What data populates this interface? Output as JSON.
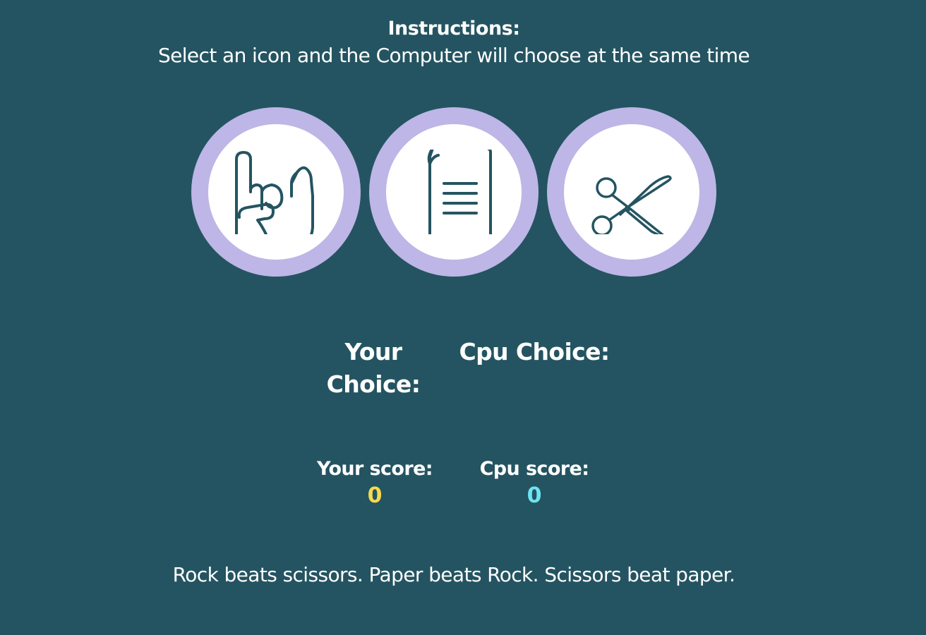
{
  "instructions": {
    "title": "Instructions:",
    "text": "Select an icon and the Computer will choose at the same time"
  },
  "choices": [
    {
      "id": "rock",
      "icon": "rock-hand-icon"
    },
    {
      "id": "paper",
      "icon": "paper-document-icon"
    },
    {
      "id": "scissors",
      "icon": "scissors-icon"
    }
  ],
  "player": {
    "choice_label": "Your Choice:",
    "score_label": "Your score:",
    "score": "0",
    "score_color": "#f5d94f"
  },
  "cpu": {
    "choice_label": "Cpu Choice:",
    "score_label": "Cpu score:",
    "score": "0",
    "score_color": "#6fe4f2"
  },
  "rules": "Rock beats scissors. Paper beats Rock. Scissors beat paper.",
  "colors": {
    "background": "#245461",
    "button_ring": "#bdb6e6",
    "button_face": "#ffffff",
    "icon_stroke": "#245461"
  }
}
